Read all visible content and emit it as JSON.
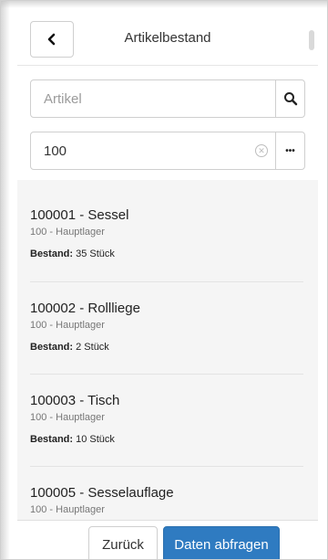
{
  "header": {
    "title": "Artikelbestand"
  },
  "search": {
    "article_placeholder": "Artikel",
    "store_value": "100",
    "more_label": "•••"
  },
  "items": [
    {
      "title": "100001 - Sessel",
      "store": "100 - Hauptlager",
      "stock_label": "Bestand:",
      "stock_value": "35 Stück"
    },
    {
      "title": "100002 - Rollliege",
      "store": "100 - Hauptlager",
      "stock_label": "Bestand:",
      "stock_value": "2 Stück"
    },
    {
      "title": "100003 - Tisch",
      "store": "100 - Hauptlager",
      "stock_label": "Bestand:",
      "stock_value": "10 Stück"
    },
    {
      "title": "100005 - Sesselauflage",
      "store": "100 - Hauptlager"
    }
  ],
  "footer": {
    "back_label": "Zurück",
    "query_label": "Daten abfragen"
  },
  "colors": {
    "primary": "#2f7bc1"
  }
}
